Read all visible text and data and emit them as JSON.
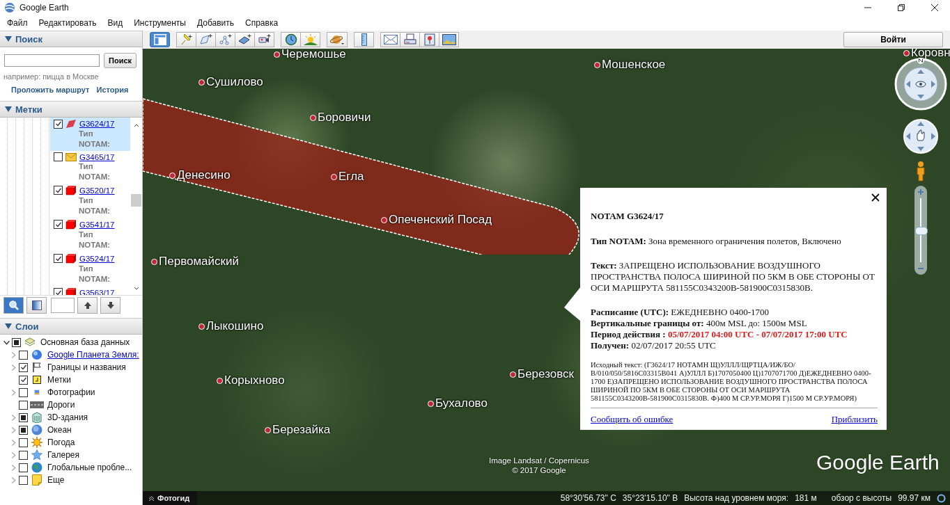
{
  "window": {
    "title": "Google Earth"
  },
  "menu": [
    "Файл",
    "Редактировать",
    "Вид",
    "Инструменты",
    "Добавить",
    "Справка"
  ],
  "search": {
    "title": "Поиск",
    "expanded": true,
    "button": "Поиск",
    "hint": "например: пицца в Москве",
    "links": [
      "Проложить маршрут",
      "История"
    ]
  },
  "places": {
    "title": "Метки",
    "expanded": true,
    "items": [
      {
        "name": "G3624/17",
        "desc": "Тип NOTAM:",
        "checked": true,
        "selected": true,
        "kind": "polygon"
      },
      {
        "name": "G3465/17",
        "desc": "Тип NOTAM:",
        "checked": false,
        "selected": false,
        "kind": "envelope"
      },
      {
        "name": "G3520/17",
        "desc": "Тип NOTAM:",
        "checked": true,
        "selected": false,
        "kind": "cube"
      },
      {
        "name": "G3541/17",
        "desc": "Тип NOTAM:",
        "checked": true,
        "selected": false,
        "kind": "cube"
      },
      {
        "name": "G3524/17",
        "desc": "Тип NOTAM:",
        "checked": true,
        "selected": false,
        "kind": "cube"
      },
      {
        "name": "G3563/17",
        "checked": true,
        "selected": false,
        "kind": "cube"
      }
    ]
  },
  "places_tools": [
    {
      "kind": "search",
      "selected": true
    },
    {
      "kind": "split",
      "selected": false
    },
    {
      "kind": "field"
    },
    {
      "kind": "up"
    },
    {
      "kind": "down"
    }
  ],
  "layers": {
    "title": "Слои",
    "expanded": true,
    "items": [
      {
        "label": "Основная база данных",
        "checked": false,
        "partial": true,
        "expandable": true,
        "expanded": true,
        "kind": "database",
        "link": false,
        "children": [
          {
            "label": "Google Планета Земля:",
            "checked": false,
            "partial": false,
            "expandable": true,
            "expanded": false,
            "kind": "globe",
            "link": true
          },
          {
            "label": "Границы и названия",
            "checked": true,
            "partial": false,
            "expandable": true,
            "expanded": false,
            "kind": "flag",
            "link": false
          },
          {
            "label": "Метки",
            "checked": true,
            "partial": false,
            "expandable": false,
            "kind": "placemark",
            "link": false
          },
          {
            "label": "Фотографии",
            "checked": false,
            "partial": false,
            "expandable": true,
            "expanded": false,
            "kind": "photo",
            "link": false
          },
          {
            "label": "Дороги",
            "checked": false,
            "partial": false,
            "expandable": false,
            "kind": "road",
            "link": false
          },
          {
            "label": "3D-здания",
            "checked": false,
            "partial": true,
            "expandable": true,
            "expanded": false,
            "kind": "building",
            "link": false
          },
          {
            "label": "Океан",
            "checked": false,
            "partial": true,
            "expandable": true,
            "expanded": false,
            "kind": "ocean",
            "link": false
          },
          {
            "label": "Погода",
            "checked": false,
            "partial": false,
            "expandable": true,
            "expanded": false,
            "kind": "sun",
            "link": false
          },
          {
            "label": "Галерея",
            "checked": false,
            "partial": false,
            "expandable": true,
            "expanded": false,
            "kind": "star",
            "link": false
          },
          {
            "label": "Глобальные пробле...",
            "checked": false,
            "partial": false,
            "expandable": true,
            "expanded": false,
            "kind": "earth",
            "link": false
          },
          {
            "label": "Еще",
            "checked": false,
            "partial": false,
            "expandable": true,
            "expanded": false,
            "kind": "note",
            "link": false
          }
        ]
      }
    ]
  },
  "toolbar": {
    "groups": [
      [
        {
          "kind": "sidebar",
          "selected": true
        }
      ],
      [
        {
          "kind": "placemark",
          "selected": false
        },
        {
          "kind": "polygon",
          "selected": false
        },
        {
          "kind": "path",
          "selected": false
        },
        {
          "kind": "overlay",
          "selected": false
        },
        {
          "kind": "tour",
          "selected": false
        }
      ],
      [
        {
          "kind": "history",
          "selected": false
        },
        {
          "kind": "sun",
          "selected": false
        }
      ],
      [
        {
          "kind": "planet",
          "selected": false
        }
      ],
      [
        {
          "kind": "ruler",
          "selected": false
        }
      ],
      [
        {
          "kind": "email",
          "selected": false
        },
        {
          "kind": "print",
          "selected": false
        },
        {
          "kind": "maps",
          "selected": false
        },
        {
          "kind": "image",
          "selected": false
        }
      ]
    ],
    "sign_in": "Войти"
  },
  "map": {
    "labels": [
      "Черемошье",
      "Мошенское",
      "Сушилово",
      "Боровичи",
      "Егла",
      "Денесино",
      "Опеченский Посад",
      "Первомайский",
      "Лыкошино",
      "Корыхново",
      "Березовск",
      "Бухалово",
      "Березайка",
      "Коровн"
    ],
    "attribution": [
      "Image Landsat / Copernicus",
      "© 2017 Google"
    ],
    "logo": "Google Earth",
    "zoom": {
      "level": 0.5
    }
  },
  "popup": {
    "title": "NOTAM G3624/17",
    "sections": [
      [
        {
          "label": "Тип NOTAM:",
          "value": "Зона временного ограничения полетов, Включено",
          "highlight": false
        }
      ],
      [
        {
          "label": "Текст:",
          "value": "ЗАПРЕЩЕНО ИСПОЛЬЗОВАНИЕ ВОЗДУШНОГО ПРОСТРАНСТВА ПОЛОСА ШИРИНОЙ ПО 5КМ В ОБЕ СТОРОНЫ ОТ ОСИ МАРШРУТА 581155С0343200В-581900С0315830В.",
          "highlight": false
        }
      ],
      [
        {
          "label": "Расписание (UTC):",
          "value": "ЕЖЕДНЕВНО 0400-1700",
          "highlight": false
        },
        {
          "label": "Вертикальные границы от:",
          "value": "400м MSL до: 1500м MSL",
          "highlight": false
        },
        {
          "label": "Период действия :",
          "value": "05/07/2017 04:00 UTC - 07/07/2017 17:00 UTC",
          "highlight": true
        },
        {
          "label": "Получен:",
          "value": "02/07/2017 20:55 UTC",
          "highlight": false
        }
      ]
    ],
    "raw": "Исходный текст: (Г3624/17 НОТАМН Щ)УЛЛЛ/ЩРТЦА/ИЖ/БО/В/010/050/5816С03315В041 А)УЛЛЛ Б)1707050400 Ц)1707071700 Д)ЕЖЕДНЕВНО 0400-1700 Е)ЗАПРЕЩЕНО ИСПОЛЬЗОВАНИЕ ВОЗДУШНОГО ПРОСТРАНСТВА ПОЛОСА ШИРИНОЙ ПО 5КМ В ОБЕ СТОРОНЫ ОТ ОСИ МАРШРУТА 581155С0343200В-581900С0315830В. Ф)400 М СР.УР.МОРЯ Г)1500 М СР.УР.МОРЯ)",
    "links": [
      "Сообщить об ошибке",
      "Приблизить"
    ]
  },
  "status_bar": {
    "tour_button": "Фотогид",
    "lat": "58°30'56.73\" С",
    "lon": "35°23'15.10\" В",
    "elevation_label": "Высота над уровнем моря:",
    "elevation": "181 м",
    "eye_label": "обзор с высоты",
    "eye": "99.97 км"
  }
}
